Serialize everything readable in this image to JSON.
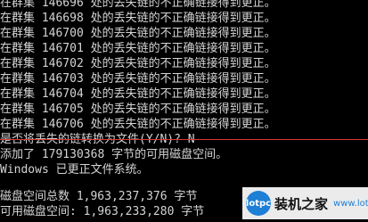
{
  "console": {
    "lines": [
      "在群集 146696 处的丢失链的不正确链接得到更正。",
      "在群集 146698 处的丢失链的不正确链接得到更正。",
      "在群集 146700 处的丢失链的不正确链接得到更正。",
      "在群集 146701 处的丢失链的不正确链接得到更正。",
      "在群集 146702 处的丢失链的不正确链接得到更正。",
      "在群集 146703 处的丢失链的不正确链接得到更正。",
      "在群集 146704 处的丢失链的不正确链接得到更正。",
      "在群集 146705 处的丢失链的不正确链接得到更正。",
      "在群集 146706 处的丢失链的不正确链接得到更正。",
      "是否将丢失的链转换为文件(Y/N)? N",
      "添加了 179130368 字节的可用磁盘空间。",
      "Windows 已更正文件系统。",
      "",
      "磁盘空间总数 1,963,237,376 字节",
      "可用磁盘空间: 1,963,233,280 字节"
    ]
  },
  "watermark": {
    "logo_text": "lotpc",
    "text": "装机之家",
    "url": "www.lotpc.com"
  },
  "colors": {
    "background": "#000000",
    "text": "#d4d4d4",
    "rule": "#d93a3a",
    "brand": "#1d7fd6"
  }
}
